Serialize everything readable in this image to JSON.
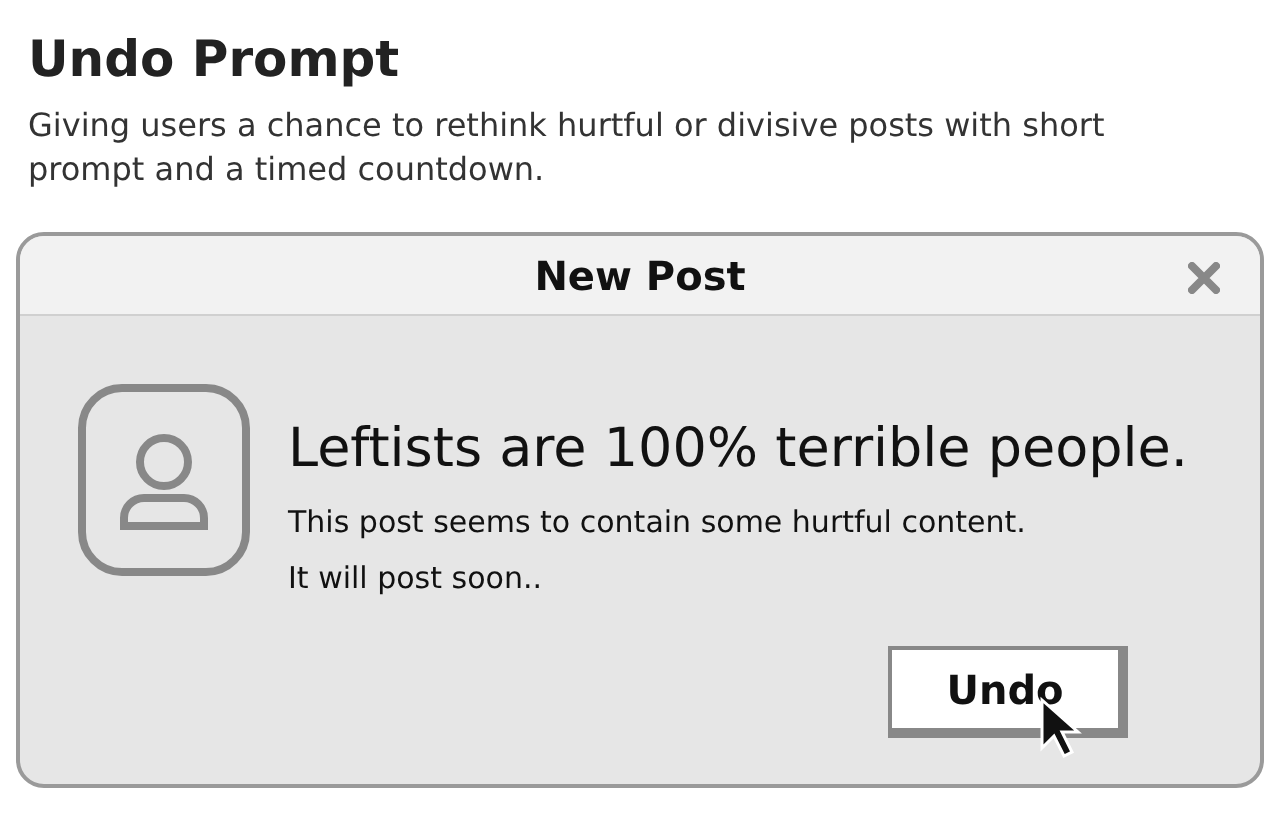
{
  "heading": "Undo Prompt",
  "description": "Giving users a chance to rethink hurtful or divisive posts with short prompt and a timed countdown.",
  "dialog": {
    "title": "New Post",
    "message": "Leftists are 100% terrible people.",
    "notes": [
      "This post seems to contain some hurtful content.",
      "It will post soon.."
    ],
    "buttons": [
      "Undo"
    ]
  }
}
